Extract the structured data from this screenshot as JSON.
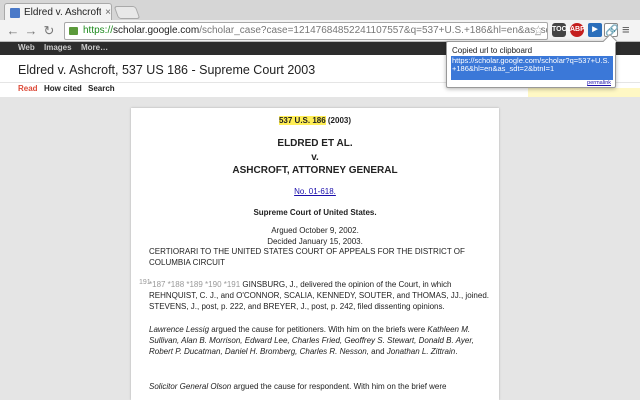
{
  "browser": {
    "tab_title": "Eldred v. Ashcroft, 537",
    "tab_close": "×",
    "url_scheme": "https://",
    "url_host": "scholar.google.com",
    "url_path": "/scholar_case?case=12147684852241107557&q=537+U.S.+186&hl=en&as_sdt=40000006",
    "back_icon": "←",
    "forward_icon": "→",
    "reload_icon": "↻",
    "star_icon": "☆",
    "ext_tools_label": "TOOL",
    "ext_abp_label": "ABP",
    "ext_blue_label": "▶",
    "ext_link_label": "🔗",
    "menu_icon": "≡"
  },
  "gbar": {
    "web": "Web",
    "images": "Images",
    "more": "More…"
  },
  "page": {
    "title": "Eldred v. Ashcroft, 537 US 186 - Supreme Court 2003",
    "subnav": [
      "Read",
      "How cited",
      "Search"
    ]
  },
  "document": {
    "cite_hl": "537 U.S. 186",
    "cite_rest": " (2003)",
    "party1": "ELDRED ET AL.",
    "party_v": "v.",
    "party2": "ASHCROFT, ATTORNEY GENERAL",
    "docket": "No. 01-618.",
    "court": "Supreme Court of United States.",
    "argued": "Argued October 9, 2002.",
    "decided": "Decided January 15, 2003.",
    "cert": "CERTIORARI TO THE UNITED STATES COURT OF APPEALS FOR THE DISTRICT OF COLUMBIA CIRCUIT",
    "margin_num": "191",
    "opinion_pages": "*187 *188 *189 *190 *191",
    "opinion_text": " GINSBURG, J., delivered the opinion of the Court, in which REHNQUIST, C. J., and O'CONNOR, SCALIA, KENNEDY, SOUTER, and THOMAS, JJ., joined. STEVENS, J., post, p. 222, and BREYER, J., post, p. 242, filed dissenting opinions.",
    "lessig_name": "Lawrence Lessig",
    "lessig_text": " argued the cause for petitioners. With him on the briefs were ",
    "lessig_names": "Kathleen M. Sullivan, Alan B. Morrison, Edward Lee, Charles Fried, Geoffrey S. Stewart, Donald B. Ayer, Robert P. Ducatman, Daniel H. Bromberg, Charles R. Nesson,",
    "lessig_and": " and ",
    "lessig_last": "Jonathan L. Zittrain",
    "lessig_end": ".",
    "olson_name": "Solicitor General Olson",
    "olson_text": " argued the cause for respondent. With him on the brief were"
  },
  "popup": {
    "title": "Copied url to clipboard",
    "url": "https://scholar.google.com/scholar?q=537+U.S.+186&hl=en&as_sdt=2&btnI=1",
    "permalink": "permalink"
  }
}
